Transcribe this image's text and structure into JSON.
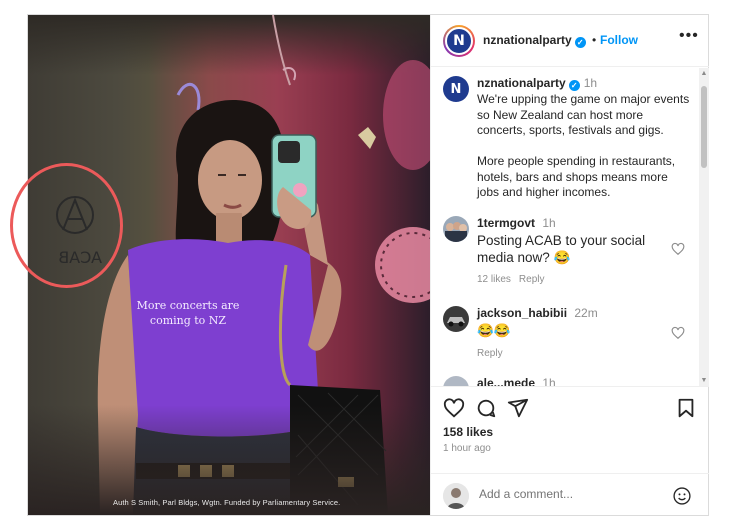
{
  "post": {
    "author": "nznationalparty",
    "follow_separator": "•",
    "follow_label": "Follow",
    "more_label": "•••",
    "avatar_letter": "N",
    "photo_overlay_text": "More concerts are coming to NZ",
    "photo_caption": "Auth S Smith, Parl Bldgs, Wgtn. Funded by Parliamentary Service.",
    "wall_graffiti": "ACAB"
  },
  "caption": {
    "author": "nznationalparty",
    "time": "1h",
    "text": "We're upping the game on major events so New Zealand can host more concerts, sports, festivals and gigs.\n\nMore people spending in restaurants, hotels, bars and shops means more jobs and higher incomes."
  },
  "comments": [
    {
      "user": "1termgovt",
      "time": "1h",
      "text": "Posting ACAB to your social media now? 😂",
      "likes": "12 likes",
      "reply": "Reply"
    },
    {
      "user": "jackson_habibii",
      "time": "22m",
      "text": "😂😂",
      "reply": "Reply"
    },
    {
      "user": "ale...mede",
      "time": "1h"
    }
  ],
  "actions": {
    "likes": "158 likes",
    "posted_ago": "1 hour ago",
    "icons": [
      "heart-icon",
      "comment-icon",
      "share-icon",
      "bookmark-icon"
    ]
  },
  "add_comment": {
    "placeholder": "Add a comment..."
  },
  "colors": {
    "accent": "#0095f6",
    "annotation_circle": "#ec5a5a",
    "shirt": "#7e3fd0"
  }
}
